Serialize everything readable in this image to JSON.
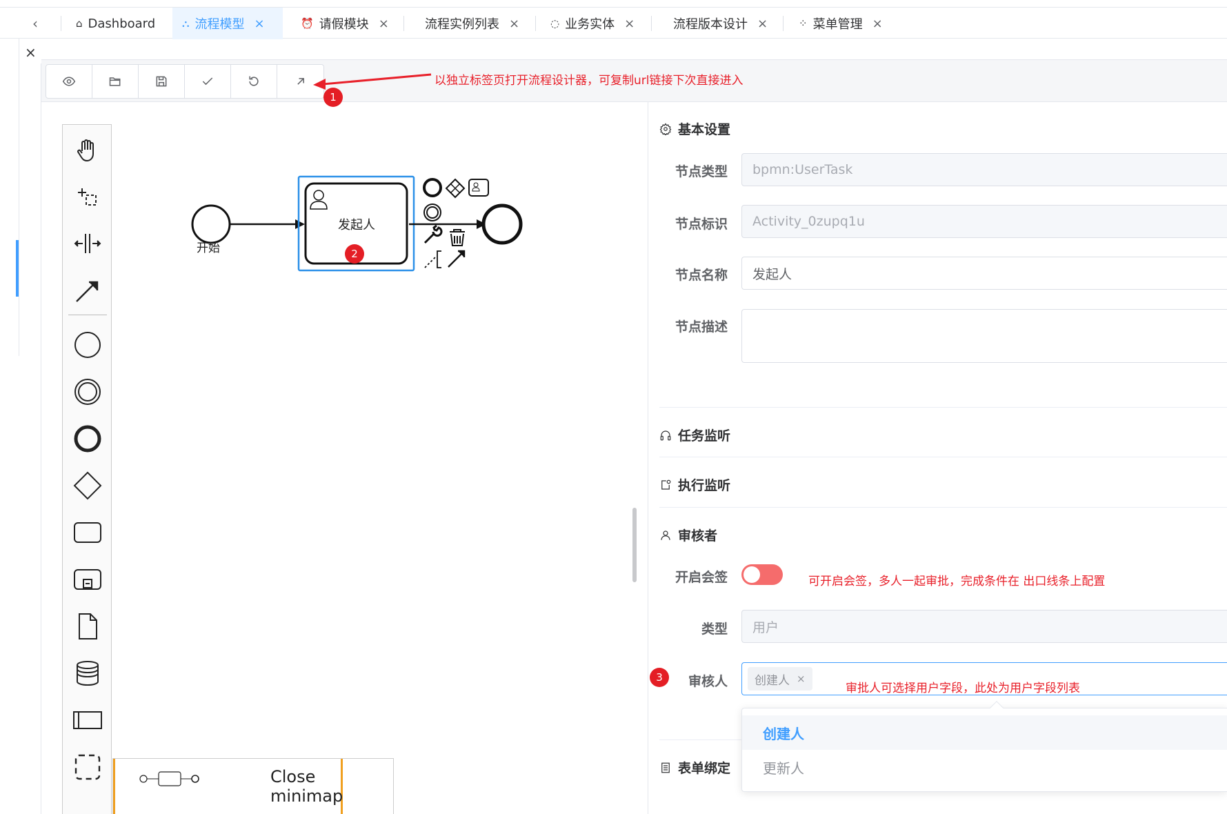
{
  "tabs": {
    "back_icon": "‹",
    "items": [
      {
        "label": "Dashboard",
        "icon": "home-icon",
        "closable": false
      },
      {
        "label": "流程模型",
        "icon": "flow-icon",
        "closable": true,
        "active": true
      },
      {
        "label": "请假模块",
        "icon": "alarm-icon",
        "closable": true
      },
      {
        "label": "流程实例列表",
        "icon": "",
        "closable": true
      },
      {
        "label": "业务实体",
        "icon": "apple-icon",
        "closable": true
      },
      {
        "label": "流程版本设计",
        "icon": "",
        "closable": true
      },
      {
        "label": "菜单管理",
        "icon": "grid-icon",
        "closable": true
      }
    ],
    "close_glyph": "×"
  },
  "toolbar": {
    "buttons": [
      "preview-icon",
      "open-icon",
      "save-icon",
      "check-icon",
      "undo-icon",
      "external-open-icon"
    ]
  },
  "annotations": {
    "a1_text": "以独立标签页打开流程设计器，可复制url链接下次直接进入",
    "a1_badge": "1",
    "a2_badge": "2",
    "a3_badge": "3",
    "multi_sign_note": "可开启会签，多人一起审批，完成条件在 出口线条上配置",
    "approver_note": "审批人可选择用户字段，此处为用户字段列表",
    "color": "#e8202a"
  },
  "diagram": {
    "start_label": "开始",
    "task_label": "发起人"
  },
  "minimap": {
    "label": "Close minimap"
  },
  "panel": {
    "basic_settings": "基本设置",
    "node_type_label": "节点类型",
    "node_type_value": "bpmn:UserTask",
    "node_id_label": "节点标识",
    "node_id_value": "Activity_0zupq1u",
    "node_name_label": "节点名称",
    "node_name_value": "发起人",
    "node_desc_label": "节点描述",
    "task_listener": "任务监听",
    "exec_listener": "执行监听",
    "reviewer_section": "审核者",
    "multi_sign_label": "开启会签",
    "type_label": "类型",
    "type_value": "用户",
    "approver_label": "审核人",
    "approver_tag": "创建人",
    "form_binding": "表单绑定",
    "dropdown_options": [
      "创建人",
      "更新人"
    ],
    "accent_color": "#409eff",
    "switch_color": "#f56c6c"
  }
}
